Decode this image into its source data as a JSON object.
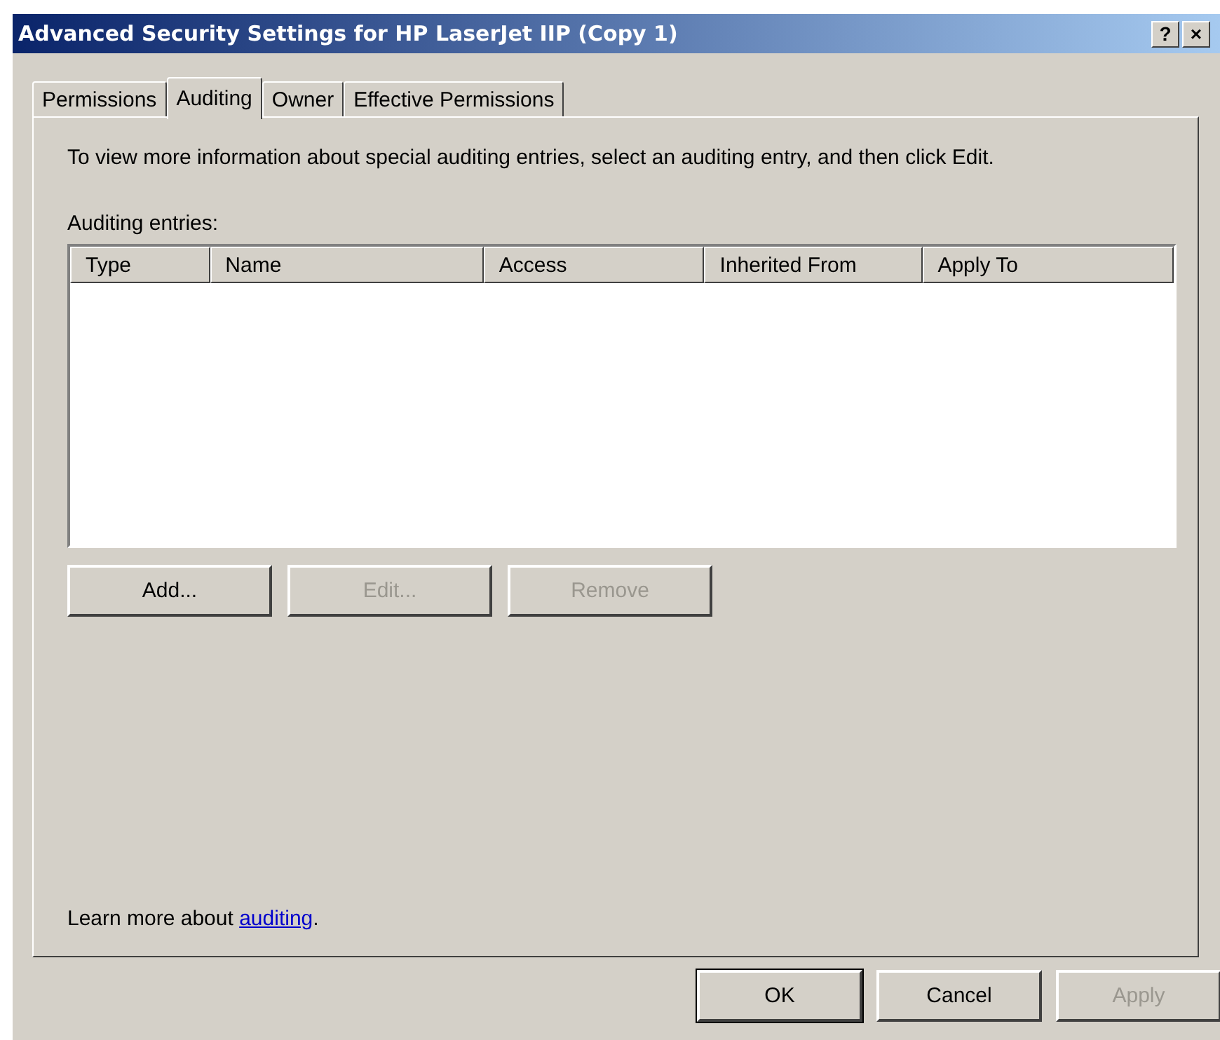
{
  "window": {
    "title": "Advanced Security Settings for HP LaserJet IIP (Copy 1)",
    "controls": [
      "?",
      "×"
    ]
  },
  "tabs": [
    {
      "label": "Permissions",
      "selected": false
    },
    {
      "label": "Auditing",
      "selected": true
    },
    {
      "label": "Owner",
      "selected": false
    },
    {
      "label": "Effective Permissions",
      "selected": false
    }
  ],
  "instructions": "To view more information about special auditing entries, select an auditing entry, and then click Edit.",
  "list": {
    "label": "Auditing entries:",
    "columns": [
      "Type",
      "Name",
      "Access",
      "Inherited From",
      "Apply To"
    ]
  },
  "list_buttons": [
    {
      "label": "Add...",
      "disabled": false
    },
    {
      "label": "Edit...",
      "disabled": true
    },
    {
      "label": "Remove",
      "disabled": true
    }
  ],
  "learn_more": {
    "text": "Learn more about ",
    "link": "auditing",
    "after": "."
  },
  "dialog_buttons": [
    {
      "label": "OK",
      "disabled": false,
      "default": true
    },
    {
      "label": "Cancel",
      "disabled": false,
      "default": false
    },
    {
      "label": "Apply",
      "disabled": true,
      "default": false
    }
  ]
}
